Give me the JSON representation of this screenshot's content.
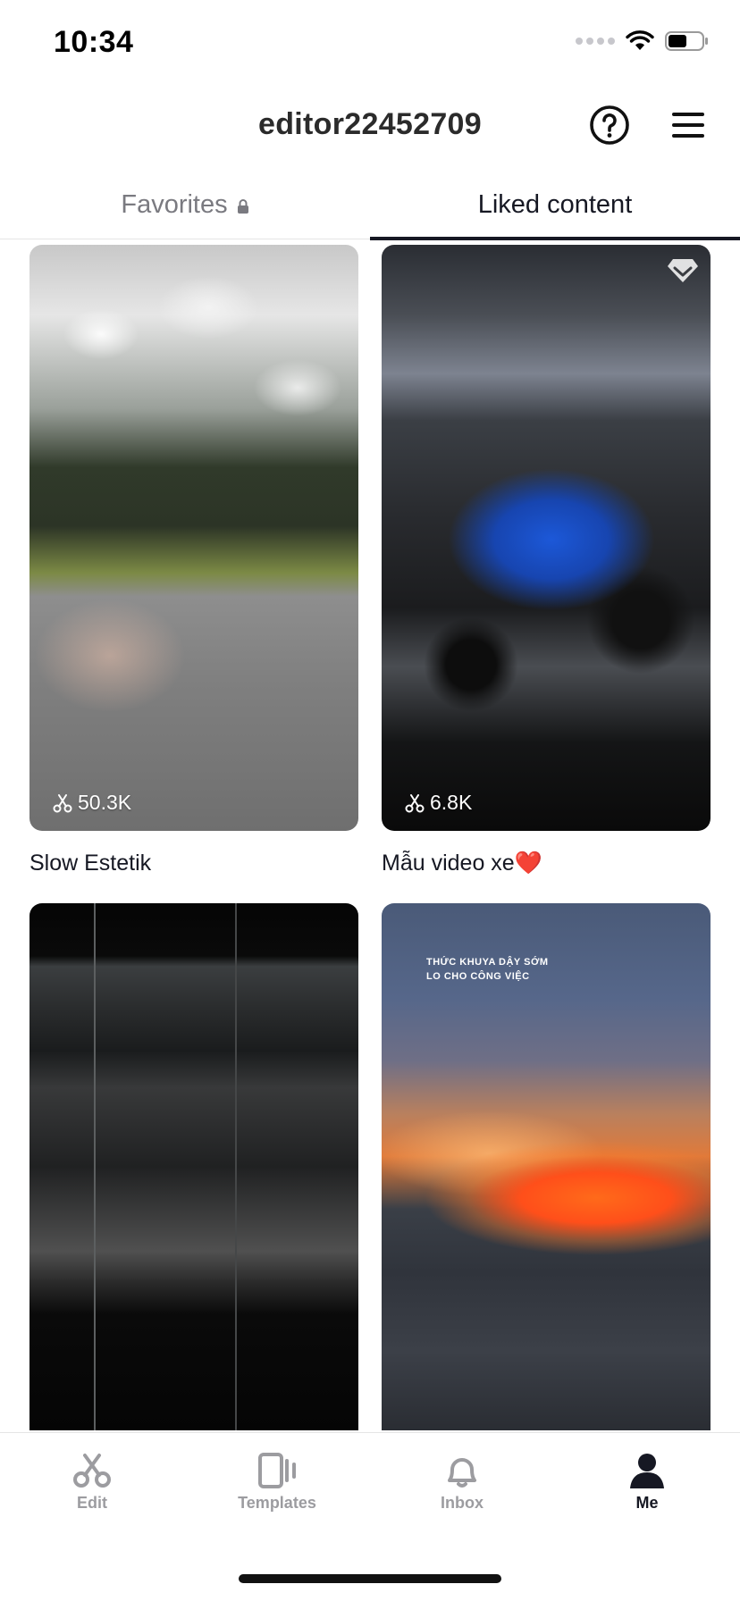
{
  "status_bar": {
    "time": "10:34"
  },
  "header": {
    "username": "editor22452709"
  },
  "tabs": [
    {
      "label": "Favorites",
      "locked": true,
      "active": false
    },
    {
      "label": "Liked content",
      "active": true
    }
  ],
  "cards": [
    {
      "uses": "50.3K",
      "title": "Slow Estetik"
    },
    {
      "uses": "6.8K",
      "title": "Mẫu video xe❤️"
    },
    {
      "uses": "",
      "title": ""
    },
    {
      "uses": "",
      "title": "",
      "overlay_text": [
        "THỨC KHUYA DẬY SỚM",
        "LO CHO CÔNG VIỆC"
      ]
    }
  ],
  "bottom_nav": [
    {
      "label": "Edit",
      "icon": "scissors-icon",
      "active": false
    },
    {
      "label": "Templates",
      "icon": "templates-icon",
      "active": false
    },
    {
      "label": "Inbox",
      "icon": "bell-icon",
      "active": false
    },
    {
      "label": "Me",
      "icon": "person-icon",
      "active": true
    }
  ],
  "colors": {
    "text": "#161823",
    "inactive": "#9c9ca0",
    "active_tab_underline": "#161823"
  }
}
